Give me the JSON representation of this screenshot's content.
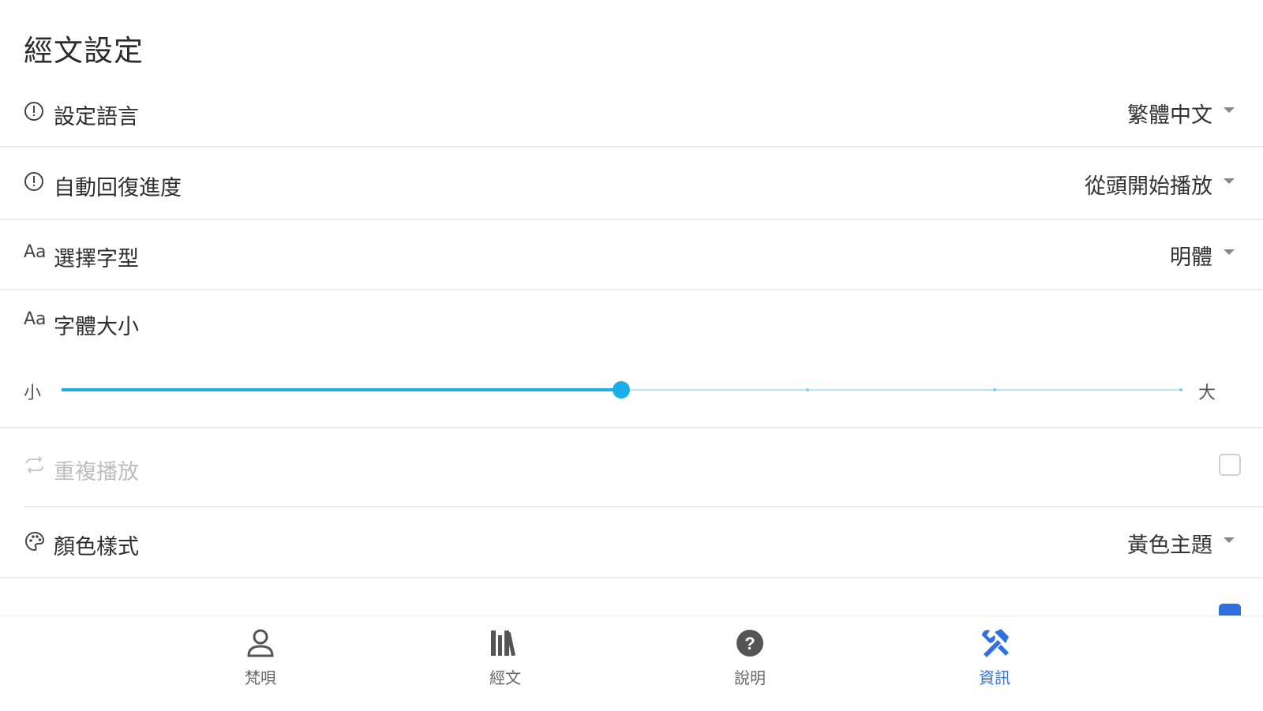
{
  "page": {
    "title": "經文設定"
  },
  "settings": {
    "language": {
      "icon": "info-circle-icon",
      "label": "設定語言",
      "value": "繁體中文"
    },
    "resume": {
      "icon": "info-circle-icon",
      "label": "自動回復進度",
      "value": "從頭開始播放"
    },
    "font_family": {
      "icon": "text-aa-icon",
      "icon_text": "Aa",
      "label": "選擇字型",
      "value": "明體"
    },
    "font_size": {
      "icon": "text-aa-icon",
      "icon_text": "Aa",
      "label": "字體大小",
      "min_label": "小",
      "max_label": "大",
      "steps": 7,
      "current_step": 4
    },
    "repeat": {
      "icon": "repeat-icon",
      "label": "重複播放",
      "checked": false,
      "disabled": true
    },
    "color_style": {
      "icon": "palette-icon",
      "label": "顏色樣式",
      "value": "黃色主題"
    }
  },
  "bottom_nav": {
    "items": [
      {
        "icon": "person-icon",
        "label": "梵唄",
        "active": false
      },
      {
        "icon": "library-icon",
        "label": "經文",
        "active": false
      },
      {
        "icon": "help-circle-icon",
        "label": "說明",
        "active": false
      },
      {
        "icon": "tools-icon",
        "label": "資訊",
        "active": true
      }
    ]
  },
  "colors": {
    "accent": "#1aaee8",
    "active_nav": "#2f6fe0",
    "divider": "#ececec"
  }
}
